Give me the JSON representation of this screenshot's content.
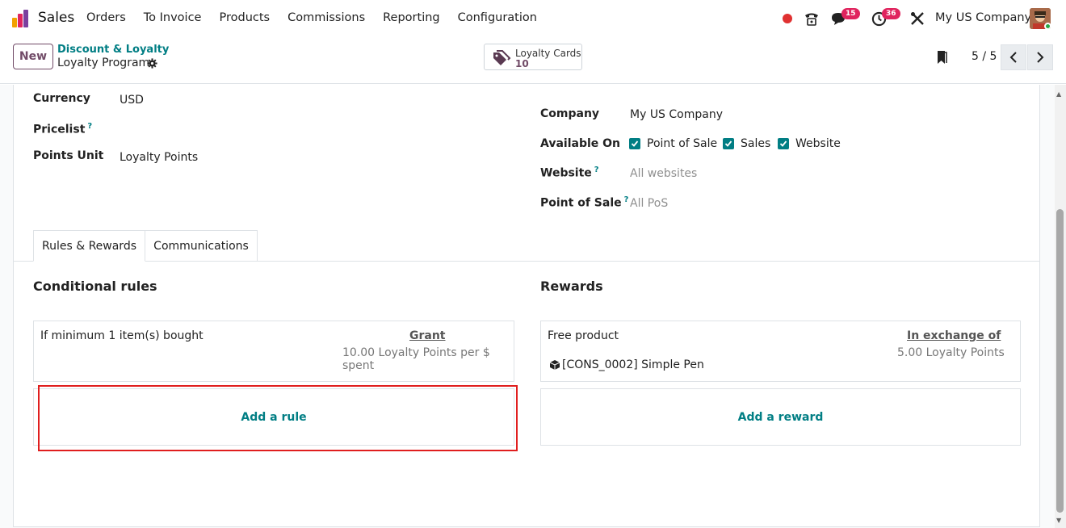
{
  "navbar": {
    "app_name": "Sales",
    "menu": [
      "Orders",
      "To Invoice",
      "Products",
      "Commissions",
      "Reporting",
      "Configuration"
    ],
    "chat_badge": "15",
    "activity_badge": "36",
    "company": "My US Company"
  },
  "control": {
    "new_label": "New",
    "breadcrumb_parent": "Discount & Loyalty",
    "breadcrumb_current": "Loyalty Program",
    "smart_button": {
      "label": "Loyalty Cards",
      "value": "10"
    },
    "pager": "5 / 5"
  },
  "form": {
    "currency": {
      "label": "Currency",
      "value": "USD"
    },
    "pricelist": {
      "label": "Pricelist",
      "tooltip": "?"
    },
    "points_unit": {
      "label": "Points Unit",
      "value": "Loyalty Points"
    },
    "company": {
      "label": "Company",
      "value": "My US Company"
    },
    "available_on": {
      "label": "Available On",
      "options": [
        {
          "label": "Point of Sale",
          "checked": true
        },
        {
          "label": "Sales",
          "checked": true
        },
        {
          "label": "Website",
          "checked": true
        }
      ]
    },
    "website": {
      "label": "Website",
      "tooltip": "?",
      "placeholder": "All websites"
    },
    "point_of_sale": {
      "label": "Point of Sale",
      "tooltip": "?",
      "placeholder": "All PoS"
    }
  },
  "tabs": [
    "Rules & Rewards",
    "Communications"
  ],
  "rules": {
    "title": "Conditional rules",
    "item": {
      "text": "If minimum 1 item(s) bought",
      "link": "Grant",
      "sub": "10.00 Loyalty Points per $ spent"
    },
    "add_label": "Add a rule"
  },
  "rewards": {
    "title": "Rewards",
    "item": {
      "text": "Free product",
      "link": "In exchange of",
      "sub": "5.00 Loyalty Points",
      "product": "[CONS_0002] Simple Pen"
    },
    "add_label": "Add a reward"
  },
  "colors": {
    "accent": "#017e84",
    "brand": "#714b67",
    "highlight": "#e01e1e"
  }
}
